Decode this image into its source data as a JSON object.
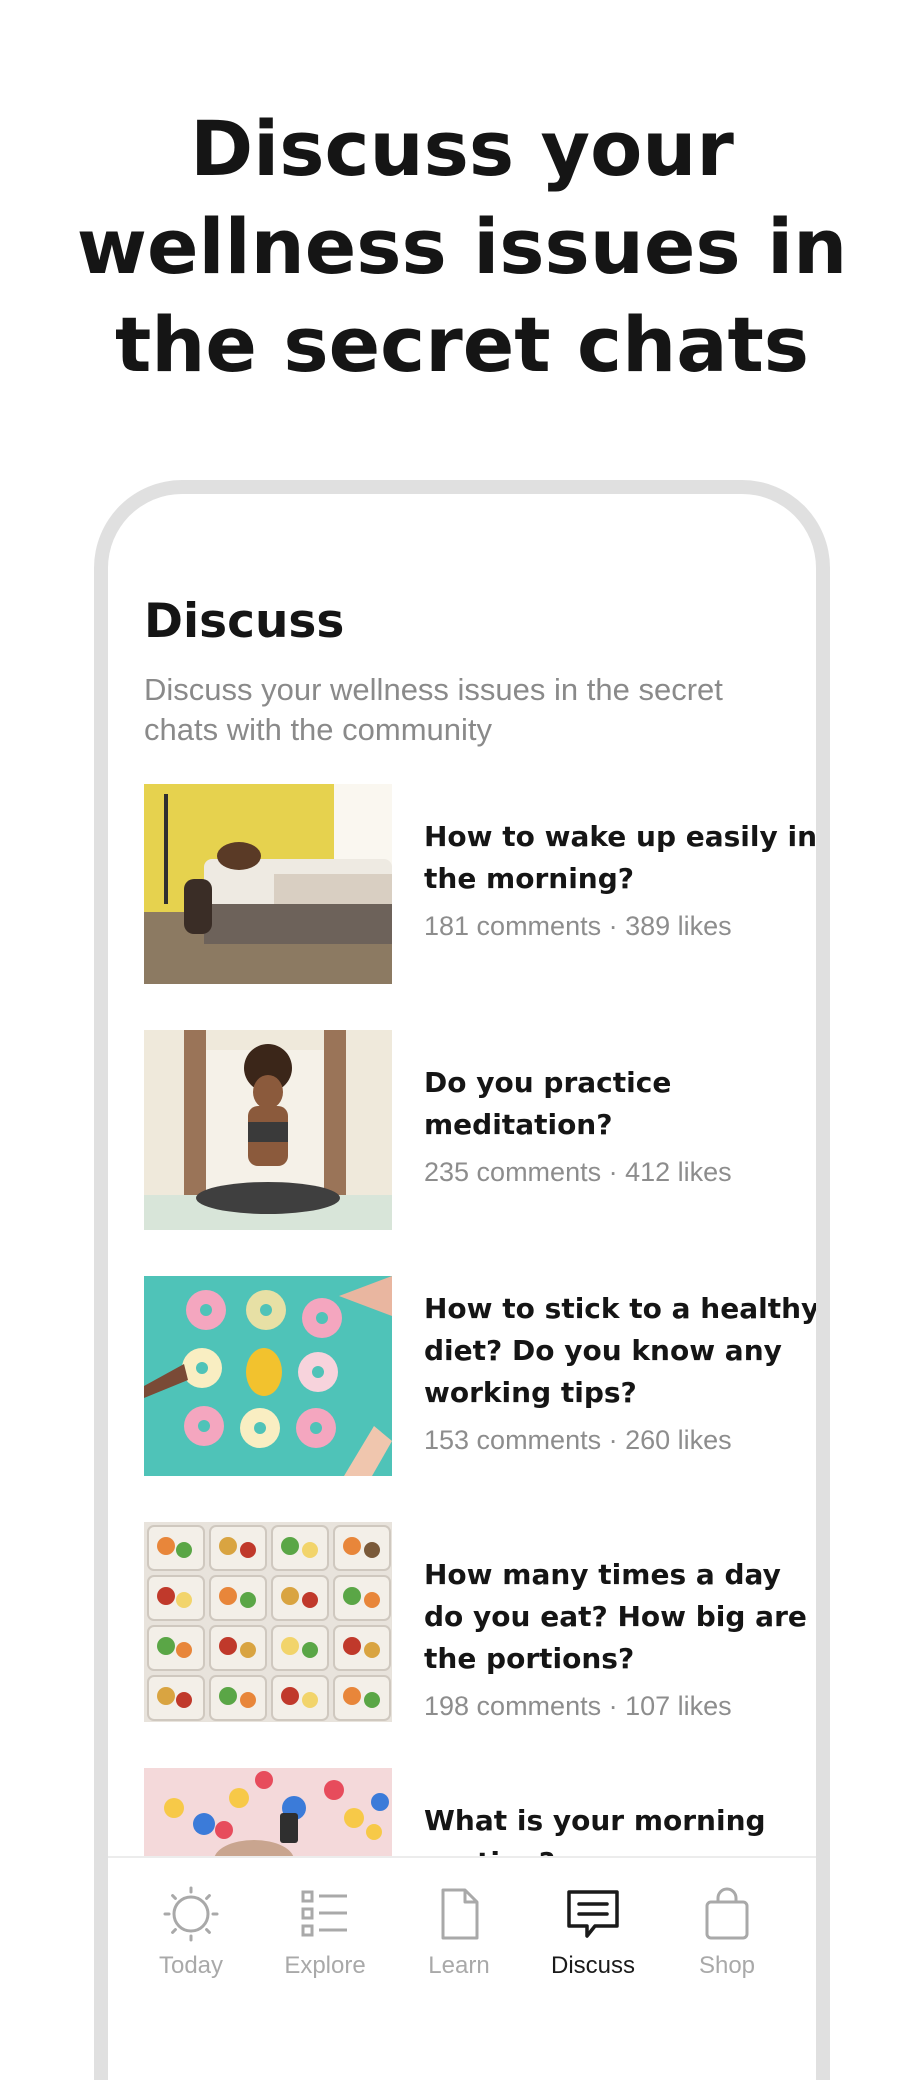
{
  "headline": {
    "line1": "Discuss your",
    "line2": "wellness issues in",
    "line3": "the secret chats"
  },
  "screen": {
    "title": "Discuss",
    "subtitle": "Discuss your wellness issues in the secret chats with the community"
  },
  "topics": [
    {
      "title": "How to wake up easily in the morning?",
      "meta": "181 comments · 389 likes"
    },
    {
      "title": "Do you practice meditation?",
      "meta": "235 comments · 412 likes"
    },
    {
      "title": "How to stick to a healthy diet? Do you know any working tips?",
      "meta": "153 comments · 260 likes"
    },
    {
      "title": "How many times a day do you eat? How big are the portions?",
      "meta": "198 comments · 107 likes"
    },
    {
      "title": "What is your morning routine?",
      "meta": ""
    }
  ],
  "tabs": [
    {
      "label": "Today",
      "icon": "sun-icon",
      "active": false
    },
    {
      "label": "Explore",
      "icon": "list-icon",
      "active": false
    },
    {
      "label": "Learn",
      "icon": "document-icon",
      "active": false
    },
    {
      "label": "Discuss",
      "icon": "chat-icon",
      "active": true
    },
    {
      "label": "Shop",
      "icon": "shopping-bag-icon",
      "active": false
    }
  ],
  "colors": {
    "active_tab": "#1a1a1a",
    "inactive_tab": "#a9a9a9",
    "meta_text": "#8d8d8d",
    "phone_frame": "#e0e0e0"
  }
}
